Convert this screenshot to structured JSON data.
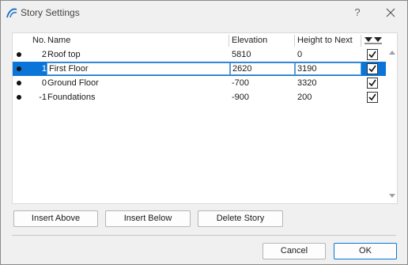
{
  "window": {
    "title": "Story Settings",
    "help": "?",
    "close": "✕"
  },
  "table": {
    "columns": [
      "No.",
      "Name",
      "Elevation",
      "Height to Next"
    ],
    "rows": [
      {
        "no": "2",
        "name": "Roof top",
        "elevation": "5810",
        "height": "0",
        "checked": true,
        "selected": false
      },
      {
        "no": "1",
        "name": "First Floor",
        "elevation": "2620",
        "height": "3190",
        "checked": true,
        "selected": true
      },
      {
        "no": "0",
        "name": "Ground Floor",
        "elevation": "-700",
        "height": "3320",
        "checked": true,
        "selected": false
      },
      {
        "no": "-1",
        "name": "Foundations",
        "elevation": "-900",
        "height": "200",
        "checked": true,
        "selected": false
      }
    ]
  },
  "buttons": {
    "insert_above": "Insert Above",
    "insert_below": "Insert Below",
    "delete_story": "Delete Story",
    "cancel": "Cancel",
    "ok": "OK"
  },
  "colors": {
    "selection": "#0a74d8",
    "dialog_bg": "#f0f0f0"
  }
}
